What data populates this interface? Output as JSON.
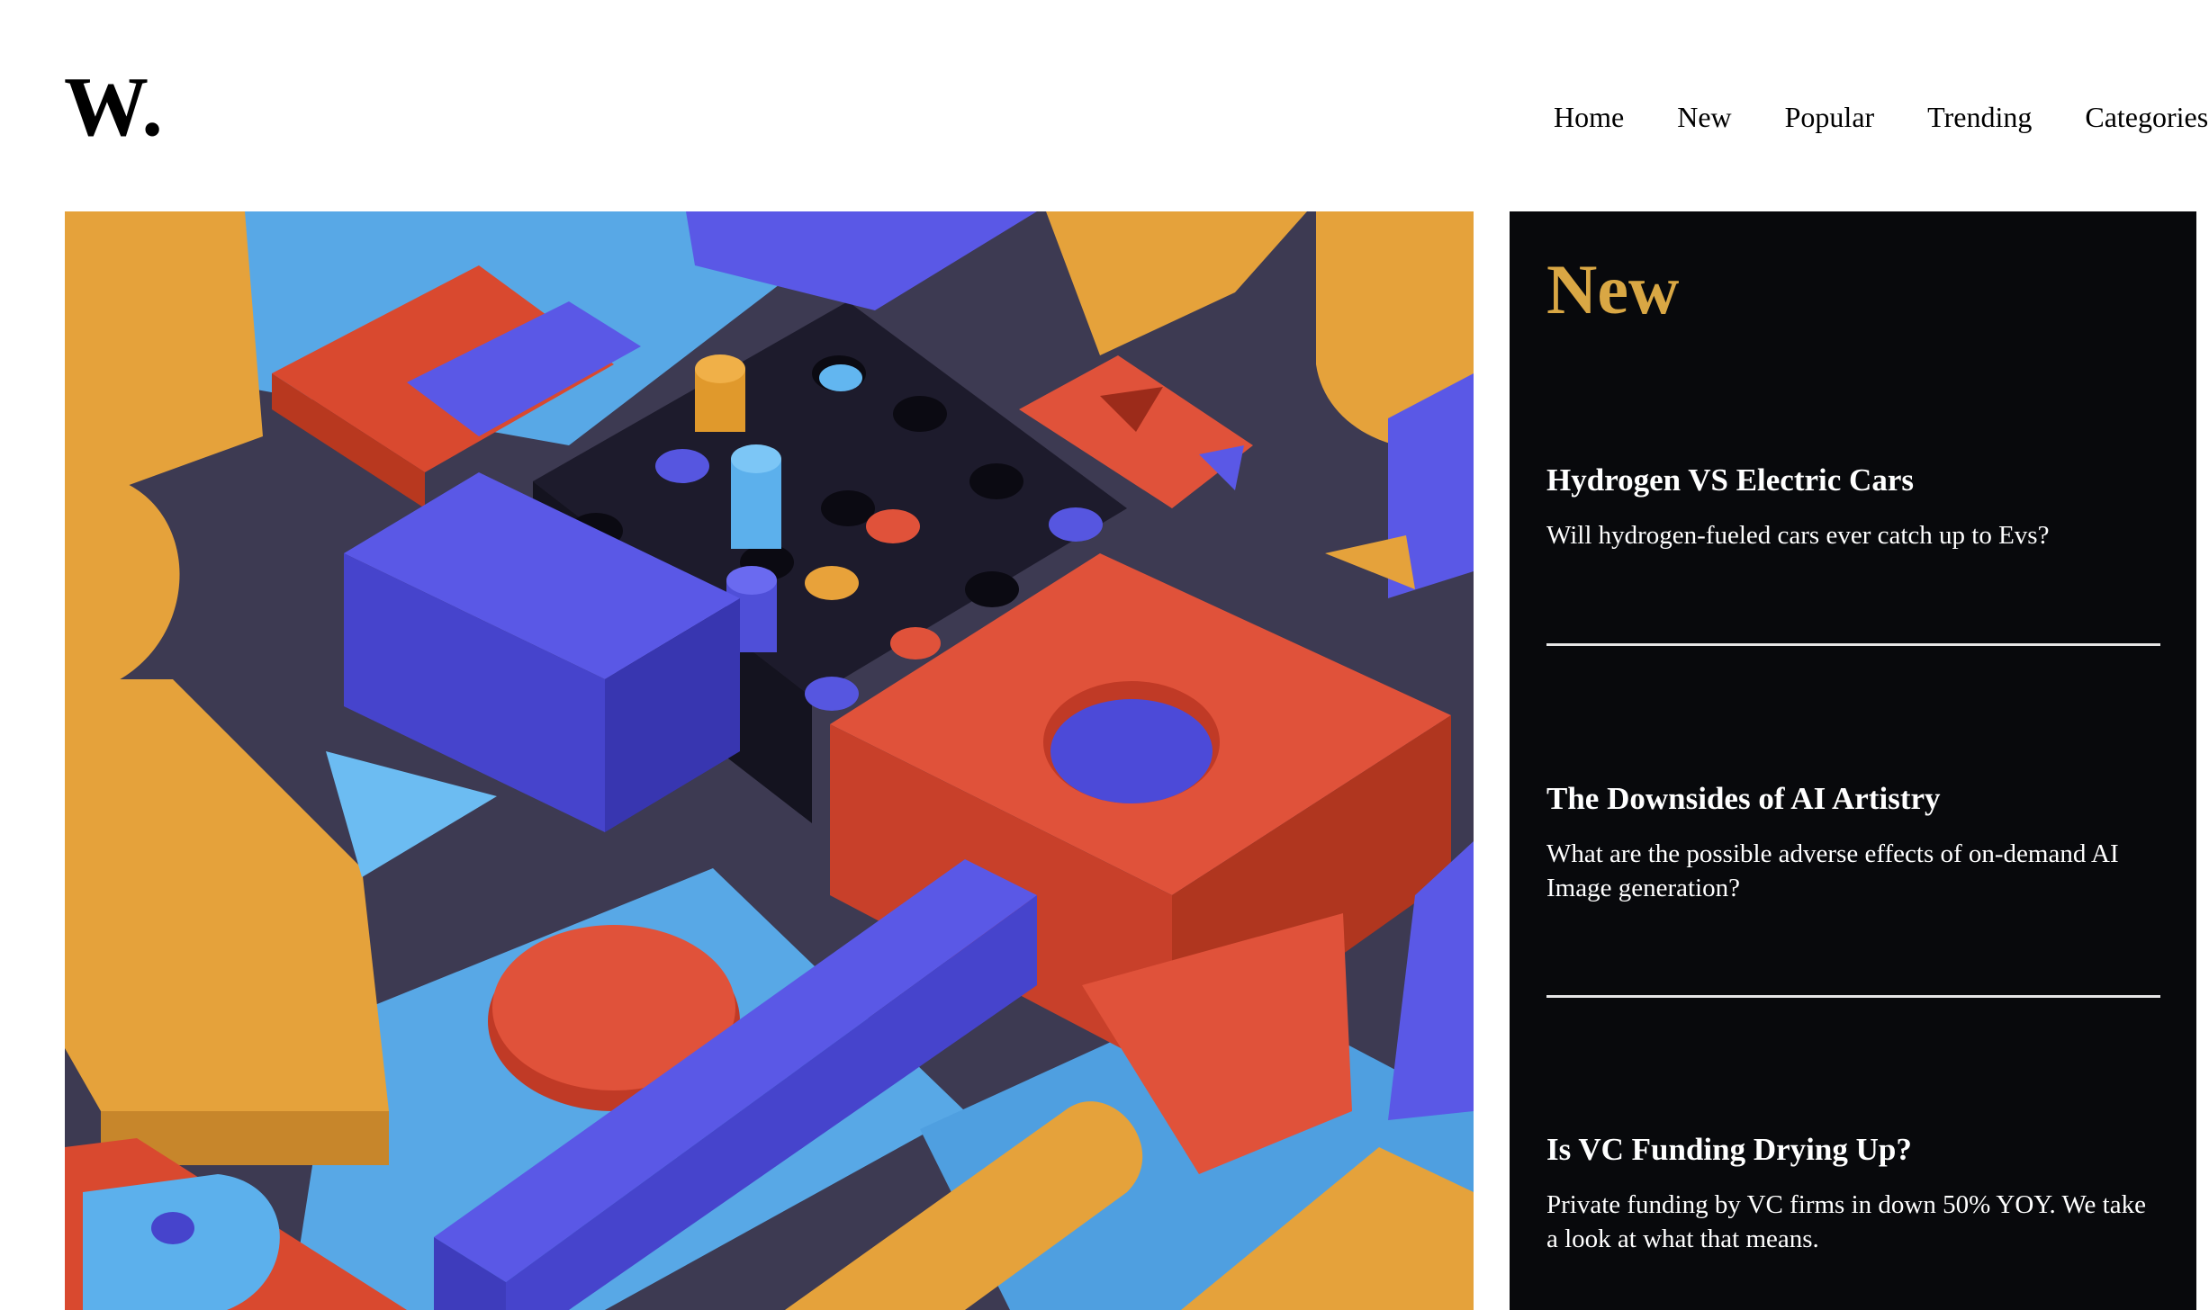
{
  "brand": {
    "logo": "W."
  },
  "nav": {
    "items": [
      "Home",
      "New",
      "Popular",
      "Trending",
      "Categories"
    ]
  },
  "hero": {
    "image_description_icon": "abstract-3d-shapes-image"
  },
  "sidebar": {
    "title": "New",
    "articles": [
      {
        "title": "Hydrogen VS Electric Cars",
        "description": "Will hydrogen-fueled cars ever catch up to Evs?"
      },
      {
        "title": "The Downsides of AI Artistry",
        "description": "What are the possible adverse effects of on-demand AI Image generation?"
      },
      {
        "title": "Is VC Funding Drying Up?",
        "description": "Private funding by VC firms in down 50% YOY. We take a look at what that means."
      }
    ]
  },
  "colors": {
    "accent": "#d9a744",
    "sidebar_bg": "#08090c",
    "text": "#000000"
  }
}
